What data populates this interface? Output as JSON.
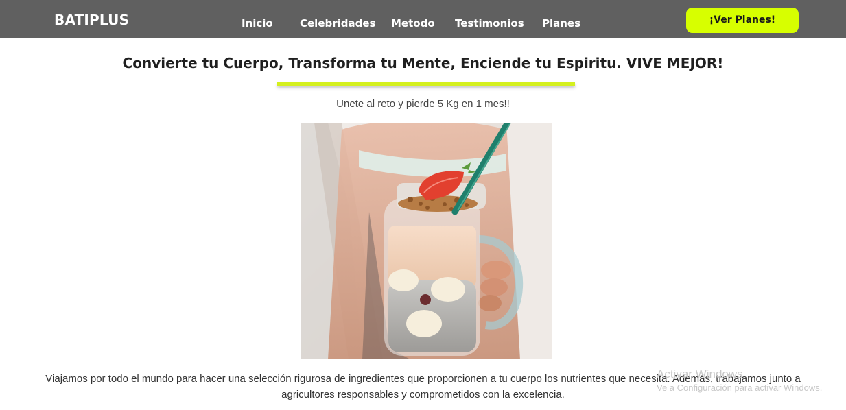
{
  "header": {
    "brand": "BATIPLUS",
    "nav": [
      "Inicio",
      "Celebridades",
      "Metodo",
      "Testimonios",
      "Planes"
    ],
    "cta_label": "¡Ver Planes!",
    "bar_color": "#606060",
    "cta_color": "#d7ff00"
  },
  "hero": {
    "headline": "Convierte tu Cuerpo, Transforma tu Mente, Enciende tu Espiritu. VIVE MEJOR!",
    "accent_color": "#d4f01e",
    "subline": "Unete al reto y pierde 5 Kg en 1 mes!!",
    "image": "smoothie-jar-photo"
  },
  "body": {
    "paragraph": "Viajamos por todo el mundo para hacer una selección rigurosa de ingredientes que proporcionen a tu cuerpo los nutrientes que necesita. Además, trabajamos junto a agricultores responsables y comprometidos con la excelencia."
  },
  "watermark": {
    "title": "Activar Windows",
    "subtitle": "Ve a Configuración para activar Windows."
  }
}
